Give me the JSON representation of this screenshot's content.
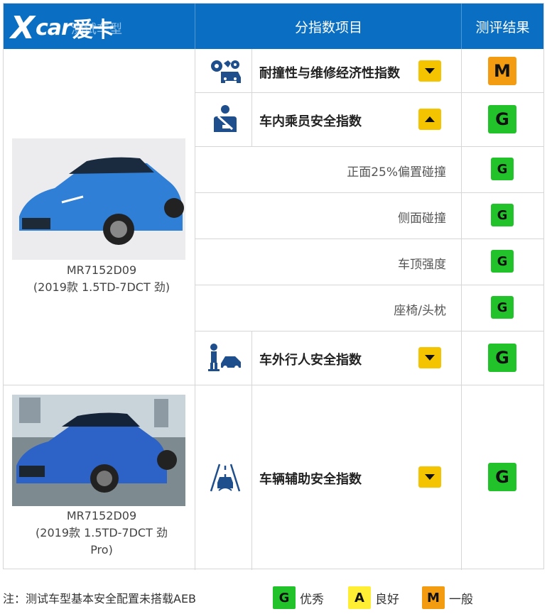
{
  "header": {
    "col1": "测试车型",
    "col2": "分指数项目",
    "col3": "测评结果",
    "logo_text": "Xcar",
    "logo_cn": "爱卡"
  },
  "indices": [
    {
      "label": "耐撞性与维修经济性指数",
      "toggle": "down",
      "rating": "M",
      "icon": "car-repair-icon"
    },
    {
      "label": "车内乘员安全指数",
      "toggle": "up",
      "rating": "G",
      "icon": "seatbelt-occupant-icon"
    },
    {
      "label": "车外行人安全指数",
      "toggle": "down",
      "rating": "G",
      "icon": "pedestrian-icon"
    },
    {
      "label": "车辆辅助安全指数",
      "toggle": "down",
      "rating": "G",
      "icon": "driver-assist-icon"
    }
  ],
  "sub_items": [
    {
      "label": "正面25%偏置碰撞",
      "rating": "G"
    },
    {
      "label": "侧面碰撞",
      "rating": "G"
    },
    {
      "label": "车顶强度",
      "rating": "G"
    },
    {
      "label": "座椅/头枕",
      "rating": "G"
    }
  ],
  "cars": [
    {
      "model": "MR7152D09",
      "variant": "(2019款 1.5TD-7DCT 劲)",
      "variant2": ""
    },
    {
      "model": "MR7152D09",
      "variant": "(2019款 1.5TD-7DCT 劲",
      "variant2": "Pro)"
    }
  ],
  "footer": {
    "note": "注：测试车型基本安全配置未搭载AEB",
    "legend": [
      {
        "letter": "G",
        "text": "优秀",
        "color": "#22c22a"
      },
      {
        "letter": "A",
        "text": "良好",
        "color": "#ffee33"
      },
      {
        "letter": "M",
        "text": "一般",
        "color": "#f39c12"
      }
    ]
  },
  "colors": {
    "header_bg": "#0a6fc2",
    "toggle": "#f5c400",
    "good": "#22c22a",
    "average": "#f39c12"
  }
}
